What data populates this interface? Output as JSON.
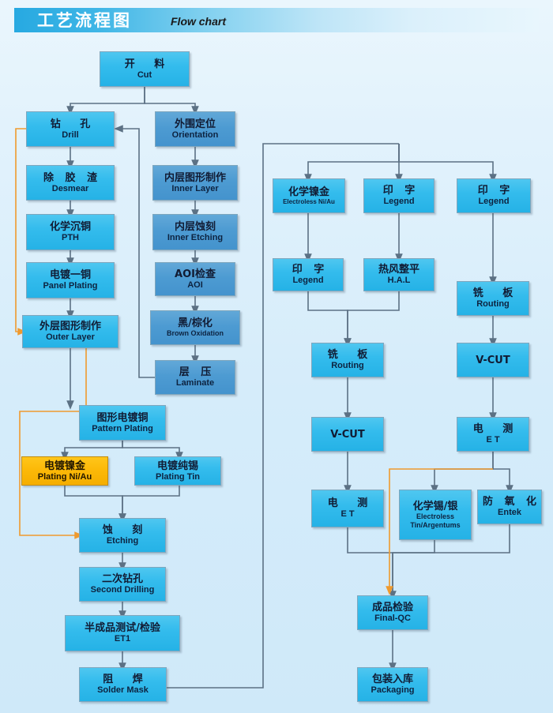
{
  "header": {
    "title_cn": "工艺流程图",
    "title_en": "Flow chart",
    "accent_color": "#27a9e1"
  },
  "palette": {
    "background": "#d9effb",
    "node_cyan": "#34bced",
    "node_blue": "#4d9bd2",
    "node_gold": "#fcb908",
    "connector_gray": "#5c7184",
    "connector_orange": "#f2a23c"
  },
  "nodes": {
    "cut": {
      "cn": "开  料",
      "en": "Cut"
    },
    "drill": {
      "cn": "钻    孔",
      "en": "Drill"
    },
    "desmear": {
      "cn": "除 胶 渣",
      "en": "Desmear"
    },
    "pth": {
      "cn": "化学沉铜",
      "en": "PTH"
    },
    "panel_plating": {
      "cn": "电镀一铜",
      "en": "Panel Plating"
    },
    "outer_layer": {
      "cn": "外层图形制作",
      "en": "Outer Layer"
    },
    "orientation": {
      "cn": "外围定位",
      "en": "Orientation"
    },
    "inner_layer": {
      "cn": "内层图形制作",
      "en": "Inner Layer"
    },
    "inner_etching": {
      "cn": "内层蚀刻",
      "en": "Inner Etching"
    },
    "aoi": {
      "cn": "AOI检查",
      "en": "AOI"
    },
    "brown_oxidation": {
      "cn": "黑/棕化",
      "en": "Brown Oxidation"
    },
    "laminate": {
      "cn": "层    压",
      "en": "Laminate"
    },
    "pattern_plating": {
      "cn": "图形电镀铜",
      "en": "Pattern Plating"
    },
    "plating_niau": {
      "cn": "电镀镍金",
      "en": "Plating Ni/Au"
    },
    "plating_tin": {
      "cn": "电镀纯锡",
      "en": "Plating Tin"
    },
    "etching": {
      "cn": "蚀    刻",
      "en": "Etching"
    },
    "second_drilling": {
      "cn": "二次钻孔",
      "en": "Second Drilling"
    },
    "et1": {
      "cn": "半成品测试/检验",
      "en": "ET1"
    },
    "solder_mask": {
      "cn": "阻    焊",
      "en": "Solder Mask"
    },
    "electroless_niau": {
      "cn": "化学镍金",
      "en": "Electroless Ni/Au"
    },
    "legend_a": {
      "cn": "印    字",
      "en": "Legend"
    },
    "legend_b": {
      "cn": "印    字",
      "en": "Legend"
    },
    "legend_c": {
      "cn": "印    字",
      "en": "Legend"
    },
    "hal": {
      "cn": "热风整平",
      "en": "H.A.L"
    },
    "routing_a": {
      "cn": "铣    板",
      "en": "Routing"
    },
    "routing_b": {
      "cn": "铣    板",
      "en": "Routing"
    },
    "vcut_a": {
      "cn": "V-CUT",
      "en": ""
    },
    "vcut_b": {
      "cn": "V-CUT",
      "en": ""
    },
    "et_a": {
      "cn": "电    测",
      "en": "E T"
    },
    "et_b": {
      "cn": "电    测",
      "en": "E T"
    },
    "electroless_tin": {
      "cn": "化学锡/银",
      "en": "Electroless Tin/Argentums"
    },
    "entek": {
      "cn": "防 氧 化",
      "en": "Entek"
    },
    "final_qc": {
      "cn": "成品检验",
      "en": "Final-QC"
    },
    "packaging": {
      "cn": "包装入库",
      "en": "Packaging"
    }
  }
}
